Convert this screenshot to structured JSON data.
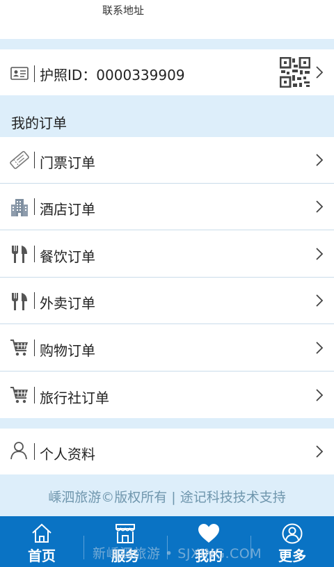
{
  "profile": {
    "address_label": "联系地址"
  },
  "passport": {
    "label": "护照ID：0000339909",
    "qr_icon": "qr-code-icon"
  },
  "orders": {
    "title": "我的订单",
    "items": [
      {
        "label": "门票订单",
        "icon": "ticket-icon"
      },
      {
        "label": "酒店订单",
        "icon": "hotel-icon"
      },
      {
        "label": "餐饮订单",
        "icon": "dining-icon"
      },
      {
        "label": "外卖订单",
        "icon": "takeout-icon"
      },
      {
        "label": "购物订单",
        "icon": "shopping-cart-icon"
      },
      {
        "label": "旅行社订单",
        "icon": "travel-agency-cart-icon"
      }
    ]
  },
  "personal": {
    "label": "个人资料",
    "icon": "user-icon"
  },
  "footer": {
    "text": "嵊泗旅游©版权所有 | 途记科技技术支持"
  },
  "watermark": {
    "text": "新嵊泗旅游 • SJXING.COM"
  },
  "tabbar": {
    "items": [
      {
        "label": "首页",
        "icon": "home-icon"
      },
      {
        "label": "服务",
        "icon": "shop-icon"
      },
      {
        "label": "我的",
        "icon": "heart-icon"
      },
      {
        "label": "更多",
        "icon": "user-circle-icon"
      }
    ]
  },
  "colors": {
    "tabbar_bg": "#0a73c4",
    "page_bg": "#ddeefa",
    "footer_text": "#6f96ad"
  }
}
